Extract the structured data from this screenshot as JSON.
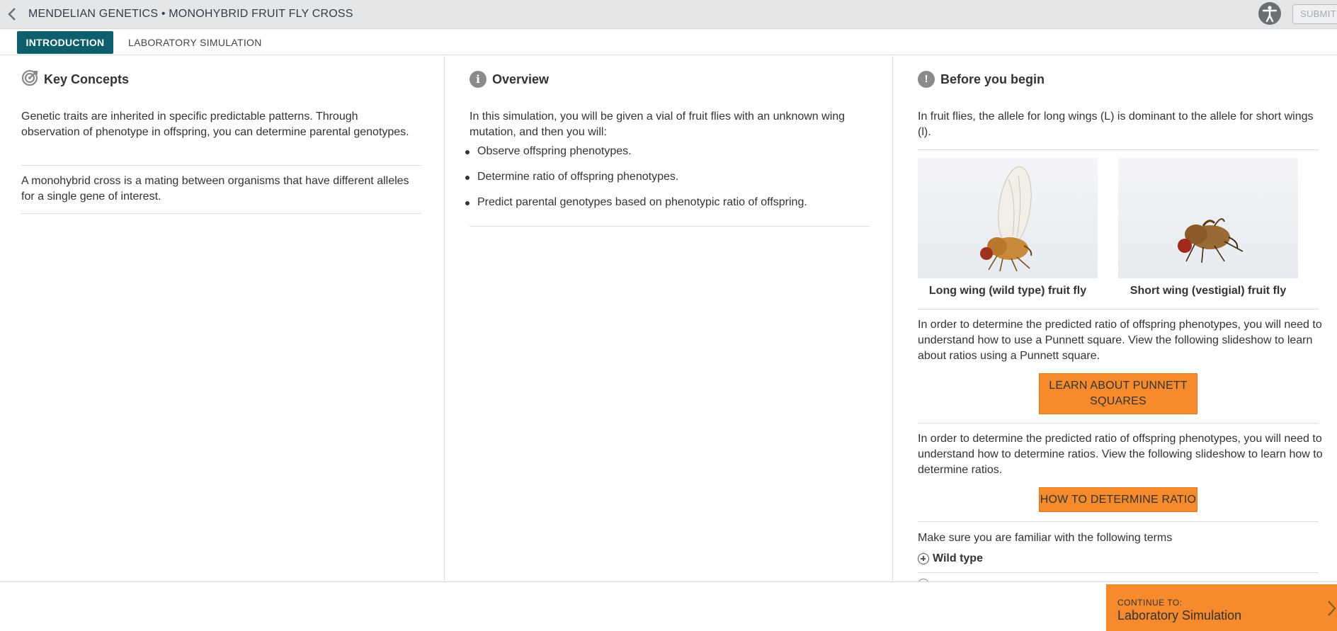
{
  "header": {
    "title": "MENDELIAN GENETICS • MONOHYBRID FRUIT FLY CROSS",
    "submit_label": "SUBMIT"
  },
  "tabs": [
    {
      "label": "INTRODUCTION",
      "active": true
    },
    {
      "label": "LABORATORY SIMULATION",
      "active": false
    }
  ],
  "key_concepts": {
    "heading": "Key Concepts",
    "icon": "target-icon",
    "paragraphs": [
      "Genetic traits are inherited in specific predictable patterns. Through observation of phenotype in offspring, you can determine parental genotypes.",
      "A monohybrid cross is a mating between organisms that have different alleles for a single gene of interest."
    ]
  },
  "overview": {
    "heading": "Overview",
    "icon": "info-icon",
    "intro": "In this simulation, you will be given a vial of fruit flies with an unknown wing mutation, and then you will:",
    "items": [
      "Observe offspring phenotypes.",
      "Determine ratio of offspring phenotypes.",
      "Predict parental genotypes based on phenotypic ratio of offspring."
    ]
  },
  "before_you_begin": {
    "heading": "Before you begin",
    "icon": "alert-icon",
    "intro": "In fruit flies, the allele for long wings (L) is dominant to the allele for short wings (l).",
    "images": [
      {
        "caption": "Long wing (wild type) fruit fly"
      },
      {
        "caption": "Short wing (vestigial) fruit fly"
      }
    ],
    "punnett_text": "In order to determine the predicted ratio of offspring phenotypes, you will need to understand how to use a Punnett square. View the following slideshow to learn about ratios using a Punnett square.",
    "punnett_button": "LEARN ABOUT PUNNETT SQUARES",
    "ratio_text": "In order to determine the predicted ratio of offspring phenotypes, you will need to understand how to determine ratios. View the following slideshow to learn how to determine ratios.",
    "ratio_button": "HOW TO DETERMINE RATIO",
    "terms_intro": "Make sure you are familiar with the following terms",
    "terms": [
      "Wild type"
    ]
  },
  "footer": {
    "continue_kicker": "CONTINUE TO:",
    "continue_destination": "Laboratory Simulation"
  },
  "colors": {
    "accent_teal": "#0d5f6e",
    "accent_orange": "#f68a2c",
    "topbar": "#e4e6e8"
  }
}
